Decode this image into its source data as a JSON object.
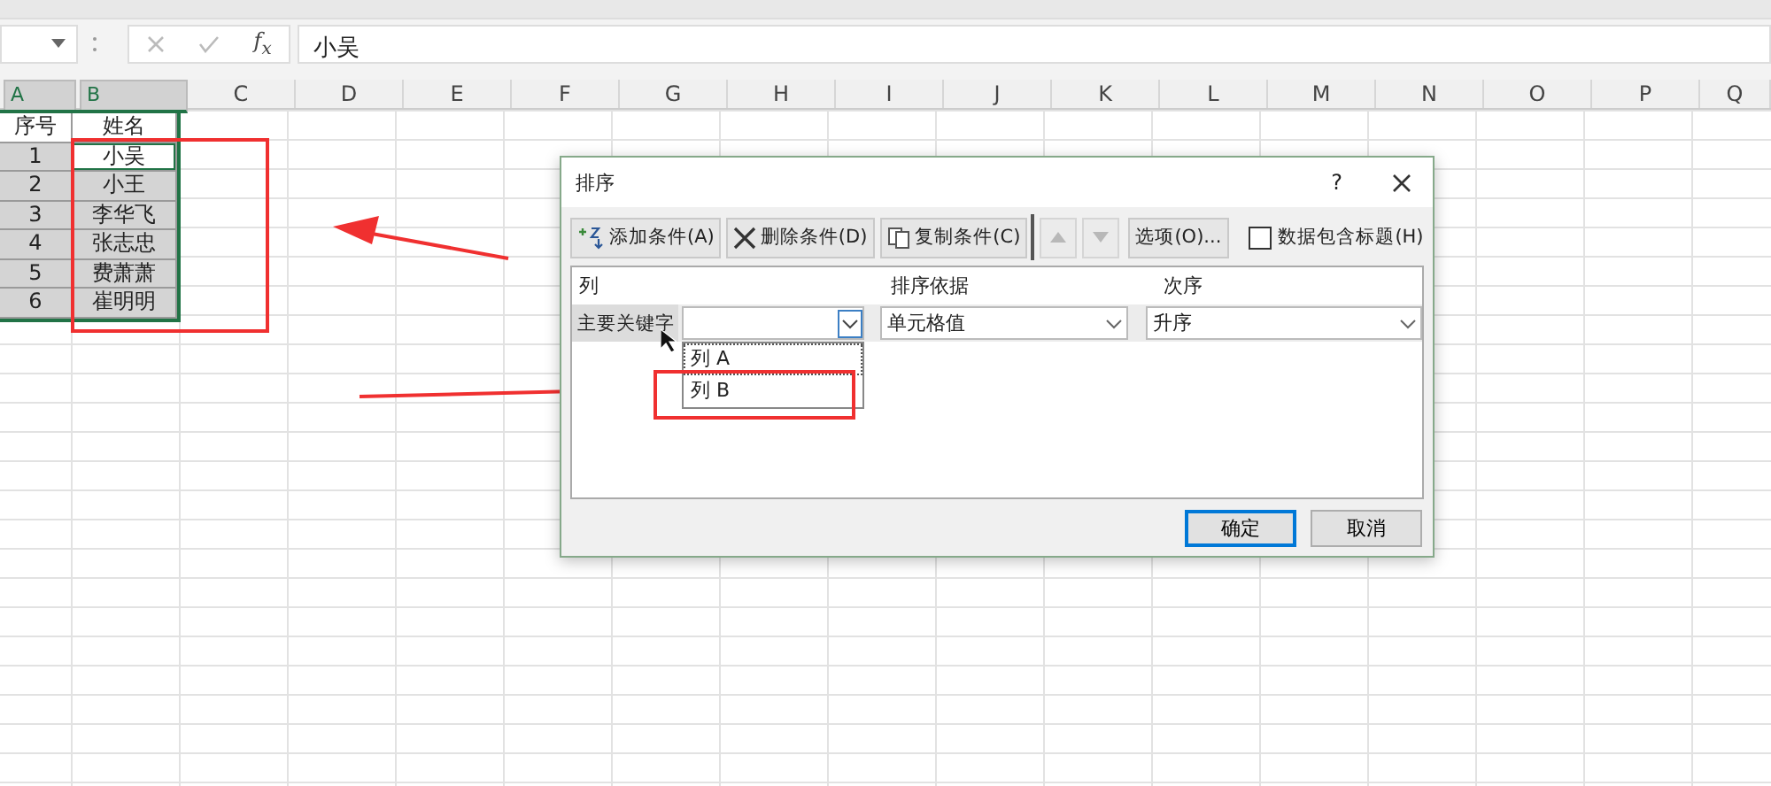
{
  "formula_bar": {
    "fx": "f$_{x}$",
    "value": "小吴"
  },
  "columns": [
    {
      "label": "A",
      "selected": true
    },
    {
      "label": "B",
      "selected": true
    },
    {
      "label": "C",
      "selected": false
    },
    {
      "label": "D",
      "selected": false
    },
    {
      "label": "E",
      "selected": false
    },
    {
      "label": "F",
      "selected": false
    },
    {
      "label": "G",
      "selected": false
    },
    {
      "label": "H",
      "selected": false
    },
    {
      "label": "I",
      "selected": false
    },
    {
      "label": "J",
      "selected": false
    },
    {
      "label": "K",
      "selected": false
    },
    {
      "label": "L",
      "selected": false
    },
    {
      "label": "M",
      "selected": false
    },
    {
      "label": "N",
      "selected": false
    },
    {
      "label": "O",
      "selected": false
    },
    {
      "label": "P",
      "selected": false
    },
    {
      "label": "Q",
      "selected": false
    }
  ],
  "rows": [
    {
      "cells": [
        "序号",
        "姓名"
      ],
      "selected": false,
      "active": false
    },
    {
      "cells": [
        "1",
        "小吴"
      ],
      "selected": true,
      "active": true
    },
    {
      "cells": [
        "2",
        "小王"
      ],
      "selected": true,
      "active": false
    },
    {
      "cells": [
        "3",
        "李华飞"
      ],
      "selected": true,
      "active": false
    },
    {
      "cells": [
        "4",
        "张志忠"
      ],
      "selected": true,
      "active": false
    },
    {
      "cells": [
        "5",
        "费萧萧"
      ],
      "selected": true,
      "active": false
    },
    {
      "cells": [
        "6",
        "崔明明"
      ],
      "selected": true,
      "active": false
    }
  ],
  "dialog": {
    "title": "排序",
    "help": "?",
    "toolbar": [
      {
        "label": "添加条件(A)",
        "kind": "add"
      },
      {
        "label": "删除条件(D)",
        "kind": "delete"
      },
      {
        "label": "复制条件(C)",
        "kind": "copy"
      }
    ],
    "move_buttons": [
      {
        "kind": "up",
        "disabled": true
      },
      {
        "kind": "down",
        "disabled": true
      }
    ],
    "options": "选项(O)...",
    "header_checkbox": {
      "label": "数据包含标题(H)",
      "checked": false
    },
    "headers": [
      "列",
      "排序依据",
      "次序"
    ],
    "sort_row": {
      "label": "主要关键字",
      "sort_on": "单元格值",
      "order": "升序"
    },
    "dropdown": [
      {
        "label": "列 A",
        "focused": true
      },
      {
        "label": "列 B",
        "focused": false
      }
    ],
    "buttons": [
      {
        "label": "确定",
        "default": true
      },
      {
        "label": "取消",
        "default": false
      }
    ]
  }
}
